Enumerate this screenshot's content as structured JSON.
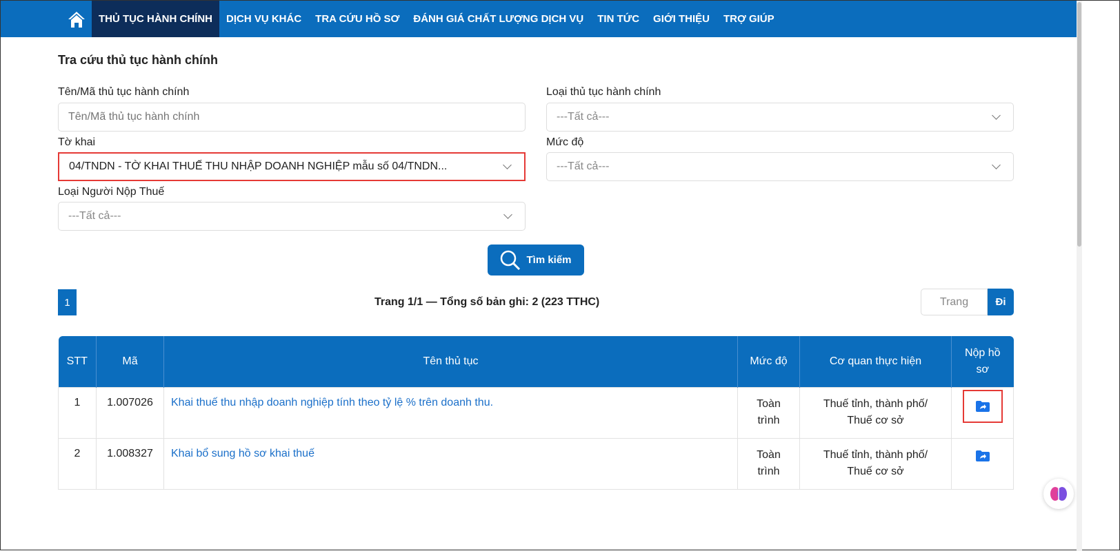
{
  "nav": {
    "items": [
      "THỦ TỤC HÀNH CHÍNH",
      "DỊCH VỤ KHÁC",
      "TRA CỨU HỒ SƠ",
      "ĐÁNH GIÁ CHẤT LƯỢNG DỊCH VỤ",
      "TIN TỨC",
      "GIỚI THIỆU",
      "TRỢ GIÚP"
    ]
  },
  "form": {
    "title": "Tra cứu thủ tục hành chính",
    "name_label": "Tên/Mã thủ tục hành chính",
    "name_placeholder": "Tên/Mã thủ tục hành chính",
    "type_label": "Loại thủ tục hành chính",
    "type_value": "---Tất cả---",
    "form_label": "Tờ khai",
    "form_value": "04/TNDN - TỜ KHAI THUẾ THU NHẬP DOANH NGHIỆP mẫu số 04/TNDN...",
    "level_label": "Mức độ",
    "level_value": "---Tất cả---",
    "payer_label": "Loại Người Nộp Thuế",
    "payer_value": "---Tất cả---",
    "search_label": "Tìm kiếm"
  },
  "pagination": {
    "current_page": "1",
    "summary": "Trang 1/1 — Tổng số bản ghi: 2 (223 TTHC)",
    "page_placeholder": "Trang",
    "go_label": "Đi"
  },
  "table": {
    "headers": [
      "STT",
      "Mã",
      "Tên thủ tục",
      "Mức độ",
      "Cơ quan thực hiện",
      "Nộp hồ sơ"
    ],
    "rows": [
      {
        "stt": "1",
        "code": "1.007026",
        "name": "Khai thuế thu nhập doanh nghiệp tính theo tỷ lệ % trên doanh thu.",
        "level": "Toàn trình",
        "agency": "Thuế tỉnh, thành phố/ Thuế cơ sở"
      },
      {
        "stt": "2",
        "code": "1.008327",
        "name": "Khai bổ sung hồ sơ khai thuế",
        "level": "Toàn trình",
        "agency": "Thuế tỉnh, thành phố/ Thuế cơ sở"
      }
    ]
  }
}
